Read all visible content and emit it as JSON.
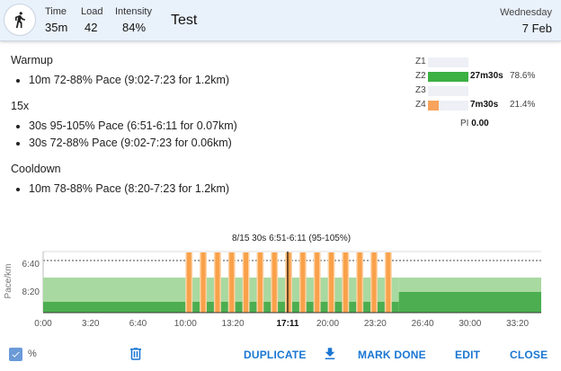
{
  "header": {
    "stats": [
      {
        "label": "Time",
        "value": "35m"
      },
      {
        "label": "Load",
        "value": "42"
      },
      {
        "label": "Intensity",
        "value": "84%"
      }
    ],
    "title": "Test",
    "weekday": "Wednesday",
    "date": "7 Feb",
    "icon": "run-icon"
  },
  "sections": [
    {
      "title": "Warmup",
      "items": [
        "10m 72-88% Pace (9:02-7:23 for 1.2km)"
      ]
    },
    {
      "title": "15x",
      "items": [
        "30s 95-105% Pace (6:51-6:11 for 0.07km)",
        "30s 72-88% Pace (9:02-7:23 for 0.06km)"
      ]
    },
    {
      "title": "Cooldown",
      "items": [
        "10m 78-88% Pace (8:20-7:23 for 1.2km)"
      ]
    }
  ],
  "zones": [
    {
      "label": "Z1",
      "time": "",
      "pct": "",
      "fraction": 0,
      "color": "#e0e3ec"
    },
    {
      "label": "Z2",
      "time": "27m30s",
      "pct": "78.6%",
      "fraction": 1.0,
      "color": "#3cb043"
    },
    {
      "label": "Z3",
      "time": "",
      "pct": "",
      "fraction": 0,
      "color": "#e0e3ec"
    },
    {
      "label": "Z4",
      "time": "7m30s",
      "pct": "21.4%",
      "fraction": 0.27,
      "color": "#f7a35c"
    }
  ],
  "pi": {
    "label": "PI",
    "value": "0.00"
  },
  "chart_data": {
    "type": "bar",
    "title": "8/15 30s 6:51-6:11 (95-105%)",
    "ylabel": "Pace/km",
    "y_ticks": [
      "6:40",
      "8:20"
    ],
    "x_ticks": [
      "0:00",
      "3:20",
      "6:40",
      "10:00",
      "13:20",
      "17:11",
      "20:00",
      "23:20",
      "26:40",
      "30:00",
      "33:20"
    ],
    "highlight_tick": "17:11",
    "x_range_seconds": [
      0,
      2100
    ],
    "cursor_seconds": 1031,
    "warmup": {
      "start": 0,
      "end": 600
    },
    "cooldown": {
      "start": 1500,
      "end": 2100
    },
    "intervals": {
      "start": 600,
      "count": 15,
      "on": 30,
      "off": 30
    },
    "colors": {
      "low": "#4cae50",
      "band": "#a8d9a0",
      "high": "#f9a14a",
      "high_band": "#fdd2a4"
    }
  },
  "toolbar": {
    "checkbox_label": "%",
    "duplicate": "DUPLICATE",
    "mark_done": "MARK DONE",
    "edit": "EDIT",
    "close": "CLOSE"
  }
}
